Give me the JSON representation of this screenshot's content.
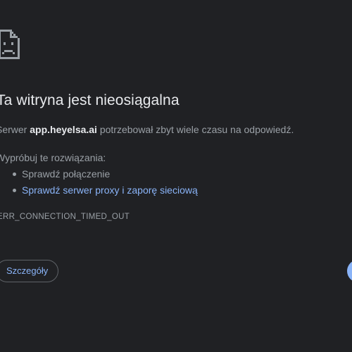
{
  "error_icon": "sad-page-icon",
  "heading": "Ta witryna jest nieosiągalna",
  "message": {
    "prefix": "Serwer ",
    "host": "app.heyelsa.ai",
    "suffix": " potrzebował zbyt wiele czasu na odpowiedź."
  },
  "suggestions": {
    "intro": "Wypróbuj te rozwiązania:",
    "items": [
      {
        "label": "Sprawdź połączenie",
        "link": false
      },
      {
        "label": "Sprawdź serwer proxy i zaporę sieciową",
        "link": true
      }
    ]
  },
  "error_code": "ERR_CONNECTION_TIMED_OUT",
  "buttons": {
    "details": "Szczegóły",
    "reload": ""
  },
  "colors": {
    "background": "#202124",
    "text": "#9aa0a6",
    "heading": "#e8eaed",
    "link": "#8ab4f8"
  }
}
